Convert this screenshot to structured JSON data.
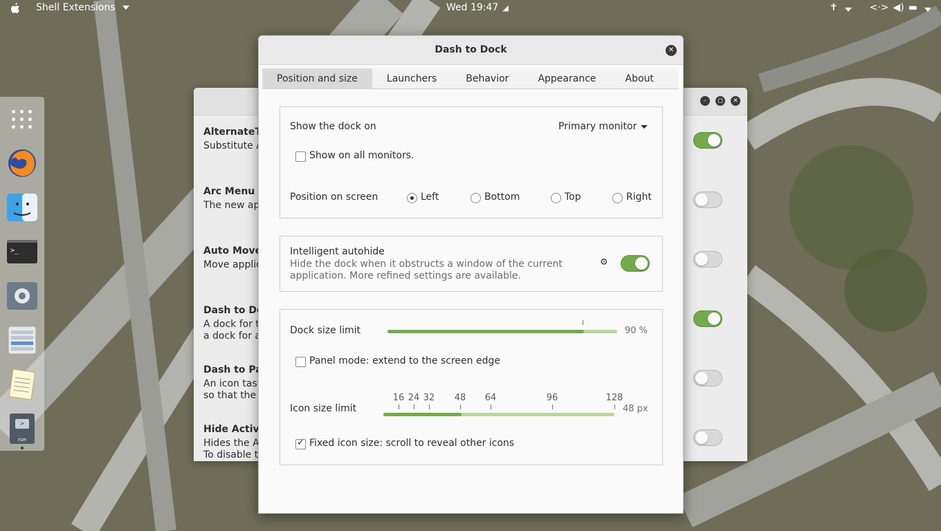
{
  "topbar": {
    "app_menu": "Shell Extensions",
    "clock": "Wed 19:47",
    "icons": [
      "apple-icon",
      "accessibility-icon",
      "network-icon",
      "volume-icon",
      "battery-icon",
      "power-caret-icon"
    ]
  },
  "dock": {
    "items": [
      "show-apps-icon",
      "firefox-icon",
      "finder-icon",
      "terminal-icon",
      "settings-icon",
      "files-icon",
      "text-editor-icon",
      "run-icon"
    ],
    "run_label": "run"
  },
  "shell_extensions": {
    "extensions": [
      {
        "title": "AlternateTa",
        "desc": [
          "Substitute A"
        ],
        "enabled": true
      },
      {
        "title": "Arc Menu",
        "desc": [
          "The new appl"
        ],
        "enabled": false
      },
      {
        "title": "Auto Move",
        "desc": [
          "Move applica"
        ],
        "enabled": false
      },
      {
        "title": "Dash to Doc",
        "desc": [
          "A dock for t",
          "a dock for an"
        ],
        "enabled": true
      },
      {
        "title": "Dash to Pan",
        "desc": [
          "An icon task",
          "so that the a"
        ],
        "enabled": false
      },
      {
        "title": "Hide Activi",
        "desc": [
          "Hides the Ac",
          "To disable t"
        ],
        "enabled": false
      }
    ]
  },
  "dialog": {
    "title": "Dash to Dock",
    "tabs": [
      "Position and size",
      "Launchers",
      "Behavior",
      "Appearance",
      "About"
    ],
    "active_tab": "Position and size",
    "monitor": {
      "label": "Show the dock on",
      "value": "Primary monitor",
      "all_monitors_label": "Show on all monitors.",
      "all_monitors_checked": false
    },
    "position": {
      "label": "Position on screen",
      "options": [
        "Left",
        "Bottom",
        "Top",
        "Right"
      ],
      "selected": "Left"
    },
    "autohide": {
      "label": "Intelligent autohide",
      "desc1": "Hide the dock when it obstructs a window of the current",
      "desc2": "application. More refined settings are available.",
      "enabled": true
    },
    "size": {
      "dock_limit_label": "Dock size limit",
      "dock_limit_value": "90 %",
      "dock_limit_fraction": 0.9,
      "panel_mode_label": "Panel mode: extend to the screen edge",
      "panel_mode_checked": false,
      "icon_limit_label": "Icon size limit",
      "icon_ticks": [
        "16",
        "24",
        "32",
        "48",
        "64",
        "96",
        "128"
      ],
      "icon_value": "48 px",
      "fixed_label": "Fixed icon size: scroll to reveal other icons",
      "fixed_checked": true
    }
  }
}
